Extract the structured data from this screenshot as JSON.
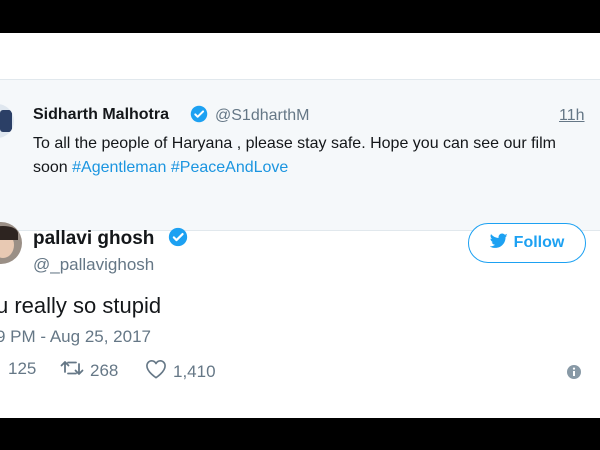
{
  "quoted_tweet": {
    "name": "Sidharth Malhotra",
    "handle": "@S1dharthM",
    "time": "11h",
    "text": "To all the people of Haryana , please stay safe. Hope you can see our film soon ",
    "hashtags": [
      "#Agentleman",
      "#PeaceAndLove"
    ]
  },
  "tweet": {
    "name": "pallavi ghosh",
    "handle": "@_pallavighosh",
    "follow_label": "Follow",
    "text": "u really so stupid",
    "timestamp": "9 PM - Aug 25, 2017",
    "replies": "125",
    "retweets": "268",
    "likes": "1,410"
  },
  "colors": {
    "accent": "#1da1f2",
    "hashtag": "#1b95e0",
    "muted": "#657786",
    "quoted_bg": "#f5f8fa"
  },
  "icons": [
    "verified-badge-icon",
    "twitter-bird-icon",
    "reply-icon",
    "retweet-icon",
    "like-icon",
    "info-icon"
  ]
}
